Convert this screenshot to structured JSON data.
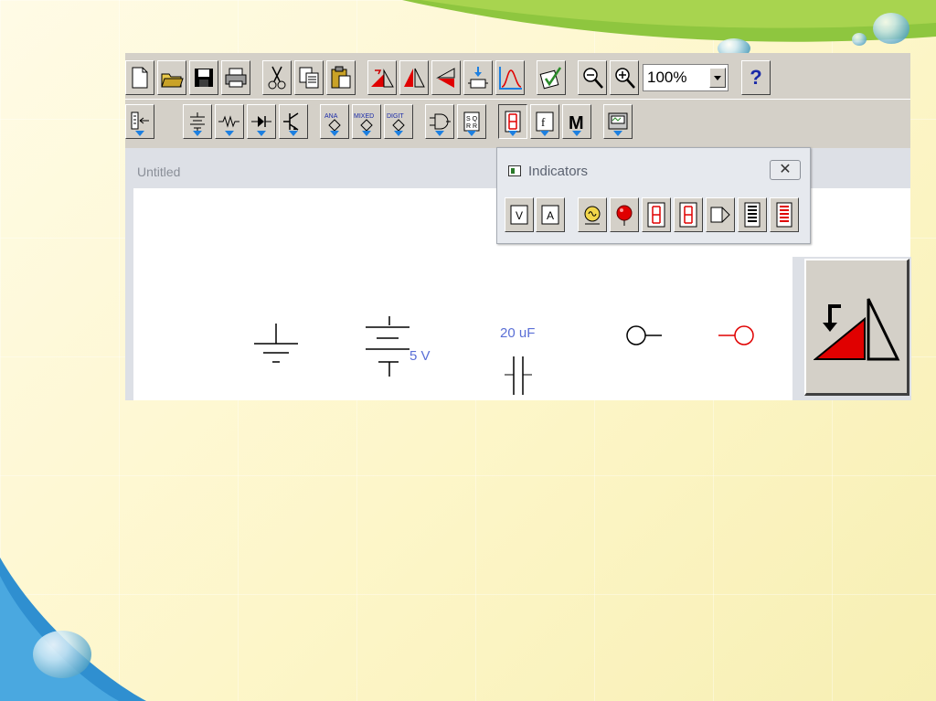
{
  "toolbar": {
    "zoom": "100%",
    "help_label": "?"
  },
  "document": {
    "title": "Untitled"
  },
  "palette": {
    "title": "Indicators",
    "close_label": "✕"
  },
  "canvas": {
    "battery_label": "5 V",
    "capacitor_label": "20 uF"
  },
  "colors": {
    "accent_red": "#e00000",
    "indicator_blue": "#1c7fe0",
    "label_blue": "#5a6fd6"
  }
}
